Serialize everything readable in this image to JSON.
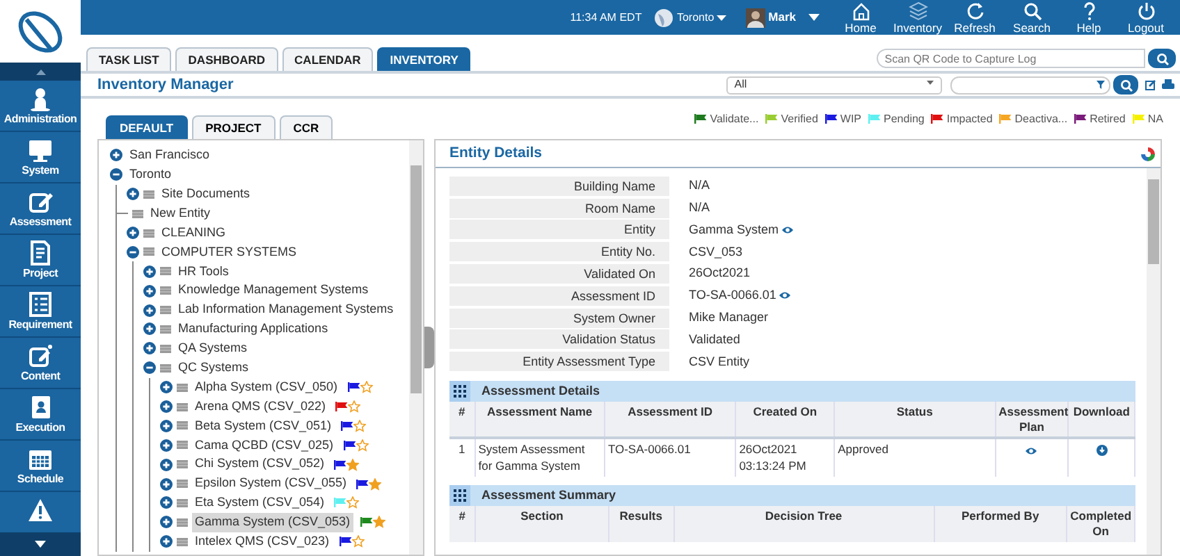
{
  "sidebar": {
    "items": [
      {
        "label": "Administration",
        "cut_off": false
      },
      {
        "label": "System",
        "cut_off": false
      },
      {
        "label": "Assessment",
        "cut_off": false
      },
      {
        "label": "Project",
        "cut_off": false
      },
      {
        "label": "Requirement",
        "cut_off": false
      },
      {
        "label": "Content",
        "cut_off": false
      },
      {
        "label": "Execution",
        "cut_off": false
      },
      {
        "label": "Schedule",
        "cut_off": false
      },
      {
        "cut_off": true
      }
    ]
  },
  "top_bar": {
    "time": "11:34 AM",
    "timezone": "EDT",
    "location": "Toronto",
    "user": "Mark",
    "nav": [
      "Home",
      "Inventory",
      "Refresh",
      "Search",
      "Help",
      "Logout"
    ]
  },
  "tabs": [
    {
      "label": "TASK LIST",
      "selected": false
    },
    {
      "label": "DASHBOARD",
      "selected": false
    },
    {
      "label": "CALENDAR",
      "selected": false
    },
    {
      "label": "INVENTORY",
      "selected": true
    }
  ],
  "qr_search": {
    "placeholder": "Scan QR Code to Capture Log"
  },
  "page_title": "Inventory Manager",
  "filter": {
    "value": "All"
  },
  "legend": [
    {
      "label": "Validate...",
      "color": "#1e7a1e"
    },
    {
      "label": "Verified",
      "color": "#9acd32"
    },
    {
      "label": "WIP",
      "color": "#1a1ae0"
    },
    {
      "label": "Pending",
      "color": "#5ef0f0"
    },
    {
      "label": "Impacted",
      "color": "#e01010"
    },
    {
      "label": "Deactiva...",
      "color": "#f5a623"
    },
    {
      "label": "Retired",
      "color": "#7a1a7a"
    },
    {
      "label": "NA",
      "color": "#f5f000"
    }
  ],
  "sub_tabs": [
    {
      "label": "DEFAULT",
      "selected": true
    },
    {
      "label": "PROJECT",
      "selected": false
    },
    {
      "label": "CCR",
      "selected": false
    }
  ],
  "tree": [
    {
      "label": "San Francisco",
      "kind": "location",
      "expanded": false,
      "selected": false
    },
    {
      "label": "Toronto",
      "kind": "location",
      "expanded": true,
      "selected": false,
      "children": [
        {
          "label": "Site Documents",
          "kind": "folder",
          "expanded": false,
          "selected": false
        },
        {
          "label": "New Entity",
          "kind": "leaf",
          "selected": false
        },
        {
          "label": "CLEANING",
          "kind": "folder",
          "expanded": false,
          "selected": false
        },
        {
          "label": "COMPUTER SYSTEMS",
          "kind": "folder",
          "expanded": true,
          "selected": false,
          "children": [
            {
              "label": "HR Tools",
              "kind": "folder",
              "expanded": false,
              "selected": false
            },
            {
              "label": "Knowledge Management Systems",
              "kind": "folder",
              "expanded": false,
              "selected": false
            },
            {
              "label": "Lab Information Management Systems",
              "kind": "folder",
              "expanded": false,
              "selected": false
            },
            {
              "label": "Manufacturing Applications",
              "kind": "folder",
              "expanded": false,
              "selected": false
            },
            {
              "label": "QA Systems",
              "kind": "folder",
              "expanded": false,
              "selected": false
            },
            {
              "label": "QC Systems",
              "kind": "folder",
              "expanded": true,
              "selected": false,
              "children": [
                {
                  "label": "Alpha System (CSV_050)",
                  "kind": "entity",
                  "expanded": false,
                  "selected": false,
                  "color": "#1a1ae0",
                  "starred": false
                },
                {
                  "label": "Arena QMS (CSV_022)",
                  "kind": "entity",
                  "expanded": false,
                  "selected": false,
                  "color": "#e01010",
                  "starred": false
                },
                {
                  "label": "Beta System (CSV_051)",
                  "kind": "entity",
                  "expanded": false,
                  "selected": false,
                  "color": "#1a1ae0",
                  "starred": false
                },
                {
                  "label": "Cama QCBD (CSV_025)",
                  "kind": "entity",
                  "expanded": false,
                  "selected": false,
                  "color": "#1a1ae0",
                  "starred": false
                },
                {
                  "label": "Chi System (CSV_052)",
                  "kind": "entity",
                  "expanded": false,
                  "selected": false,
                  "color": "#1a1ae0",
                  "starred": true
                },
                {
                  "label": "Epsilon System (CSV_055)",
                  "kind": "entity",
                  "expanded": false,
                  "selected": false,
                  "color": "#1a1ae0",
                  "starred": true
                },
                {
                  "label": "Eta System (CSV_054)",
                  "kind": "entity",
                  "expanded": false,
                  "selected": false,
                  "color": "#5ef0f0",
                  "starred": false
                },
                {
                  "label": "Gamma System (CSV_053)",
                  "kind": "entity",
                  "expanded": false,
                  "selected": true,
                  "color": "#1e8a1e",
                  "starred": true
                },
                {
                  "label": "Intelex QMS (CSV_023)",
                  "kind": "entity",
                  "expanded": false,
                  "selected": false,
                  "color": "#1a1ae0",
                  "starred": false
                }
              ]
            }
          ]
        }
      ]
    }
  ],
  "entity_details": {
    "title": "Entity Details",
    "fields": [
      {
        "label": "Building Name",
        "value": "N/A",
        "viewable": false
      },
      {
        "label": "Room Name",
        "value": "N/A",
        "viewable": false
      },
      {
        "label": "Entity",
        "value": "Gamma System",
        "viewable": true
      },
      {
        "label": "Entity No.",
        "value": "CSV_053",
        "viewable": false
      },
      {
        "label": "Validated On",
        "value": "26Oct2021",
        "viewable": false
      },
      {
        "label": "Assessment ID",
        "value": "TO-SA-0066.01",
        "viewable": true
      },
      {
        "label": "System Owner",
        "value": "Mike Manager",
        "viewable": false
      },
      {
        "label": "Validation Status",
        "value": "Validated",
        "viewable": false
      },
      {
        "label": "Entity Assessment Type",
        "value": "CSV Entity",
        "viewable": false
      }
    ],
    "assessment_details": {
      "title": "Assessment Details",
      "columns": [
        "#",
        "Assessment Name",
        "Assessment ID",
        "Created On",
        "Status",
        "Assessment Plan",
        "Download"
      ],
      "rows": [
        {
          "number": "1",
          "name": "System Assessment for Gamma System",
          "id": "TO-SA-0066.01",
          "created_on": "26Oct2021 03:13:24 PM",
          "status": "Approved"
        }
      ]
    },
    "assessment_summary": {
      "title": "Assessment Summary",
      "columns": [
        "#",
        "Section",
        "Results",
        "Decision Tree",
        "Performed By",
        "Completed On"
      ]
    }
  }
}
